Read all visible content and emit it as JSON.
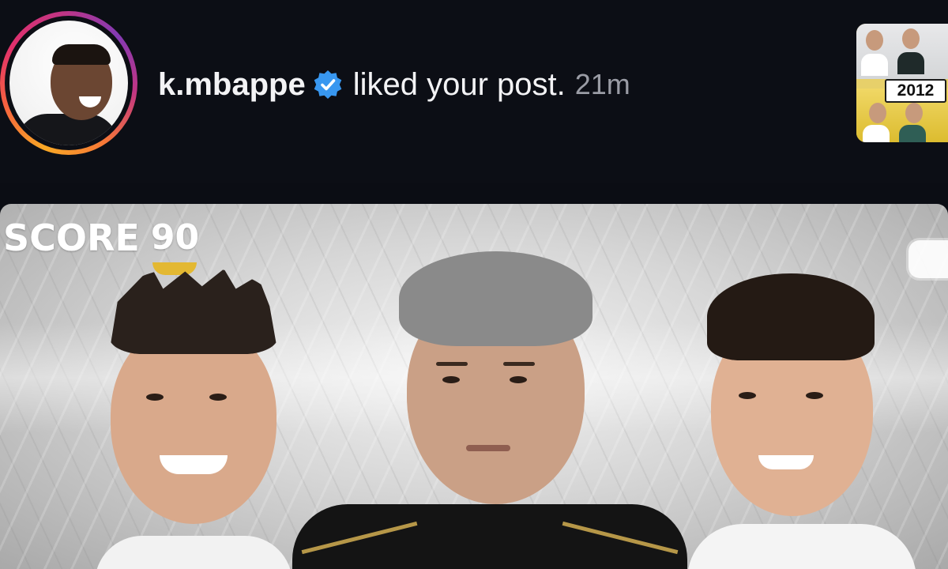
{
  "notification": {
    "username": "k.mbappe",
    "verified": true,
    "action": "liked your post.",
    "time": "21m",
    "avatar": "profile-photo",
    "thumbnail_year": "2012"
  },
  "post": {
    "score_label": "SCORE",
    "score_value": "90"
  },
  "colors": {
    "background": "#0c0e15",
    "verified_blue": "#3897f0",
    "time_gray": "#9a9ca5",
    "score_gold": "#e3b832"
  },
  "icons": [
    "verified-badge-icon",
    "media-indicator-icon"
  ]
}
